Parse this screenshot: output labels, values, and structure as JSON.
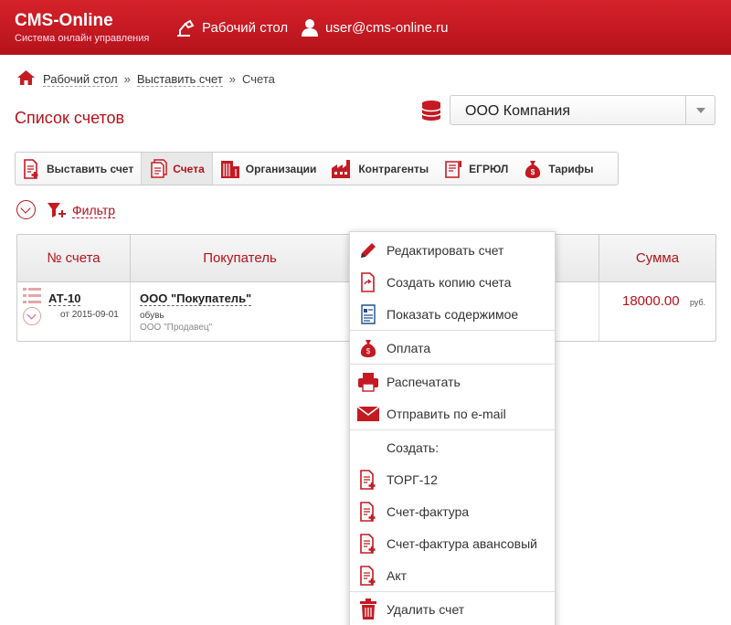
{
  "header": {
    "logo_title": "CMS-Online",
    "logo_subtitle": "Система онлайн управления",
    "desktop_link": "Рабочий стол",
    "user_email": "user@cms-online.ru"
  },
  "breadcrumb": {
    "items": [
      "Рабочий стол",
      "Выставить счет",
      "Счета"
    ],
    "separator": "»"
  },
  "page": {
    "title": "Список счетов"
  },
  "company_select": {
    "value": "ООО Компания"
  },
  "toolbar": {
    "buttons": [
      {
        "label": "Выставить счет",
        "icon": "invoice-add-icon"
      },
      {
        "label": "Счета",
        "icon": "documents-icon",
        "active": true
      },
      {
        "label": "Организации",
        "icon": "building-icon"
      },
      {
        "label": "Контрагенты",
        "icon": "factory-icon"
      },
      {
        "label": "ЕГРЮЛ",
        "icon": "registry-icon"
      },
      {
        "label": "Тарифы",
        "icon": "money-bag-icon"
      }
    ]
  },
  "filter": {
    "label": "Фильтр"
  },
  "table": {
    "columns": [
      "№ счета",
      "Покупатель",
      "Сумма"
    ],
    "rows": [
      {
        "number": "АТ-10",
        "date": "от 2015-09-01",
        "buyer": "ООО \"Покупатель\"",
        "goods": "обувь",
        "seller": "ООО \"Продавец\"",
        "amount": "18000.00",
        "currency": "руб."
      }
    ]
  },
  "context_menu": {
    "edit": "Редактировать счет",
    "copy": "Создать копию счета",
    "show": "Показать содержимое",
    "payment": "Оплата",
    "print": "Распечатать",
    "email": "Отправить по e-mail",
    "create_header": "Создать:",
    "torg12": "ТОРГ-12",
    "invoice": "Счет-фактура",
    "advance_invoice": "Счет-фактура авансовый",
    "act": "Акт",
    "delete": "Удалить счет"
  },
  "colors": {
    "brand": "#c41a22",
    "accent_text": "#b5121b"
  }
}
